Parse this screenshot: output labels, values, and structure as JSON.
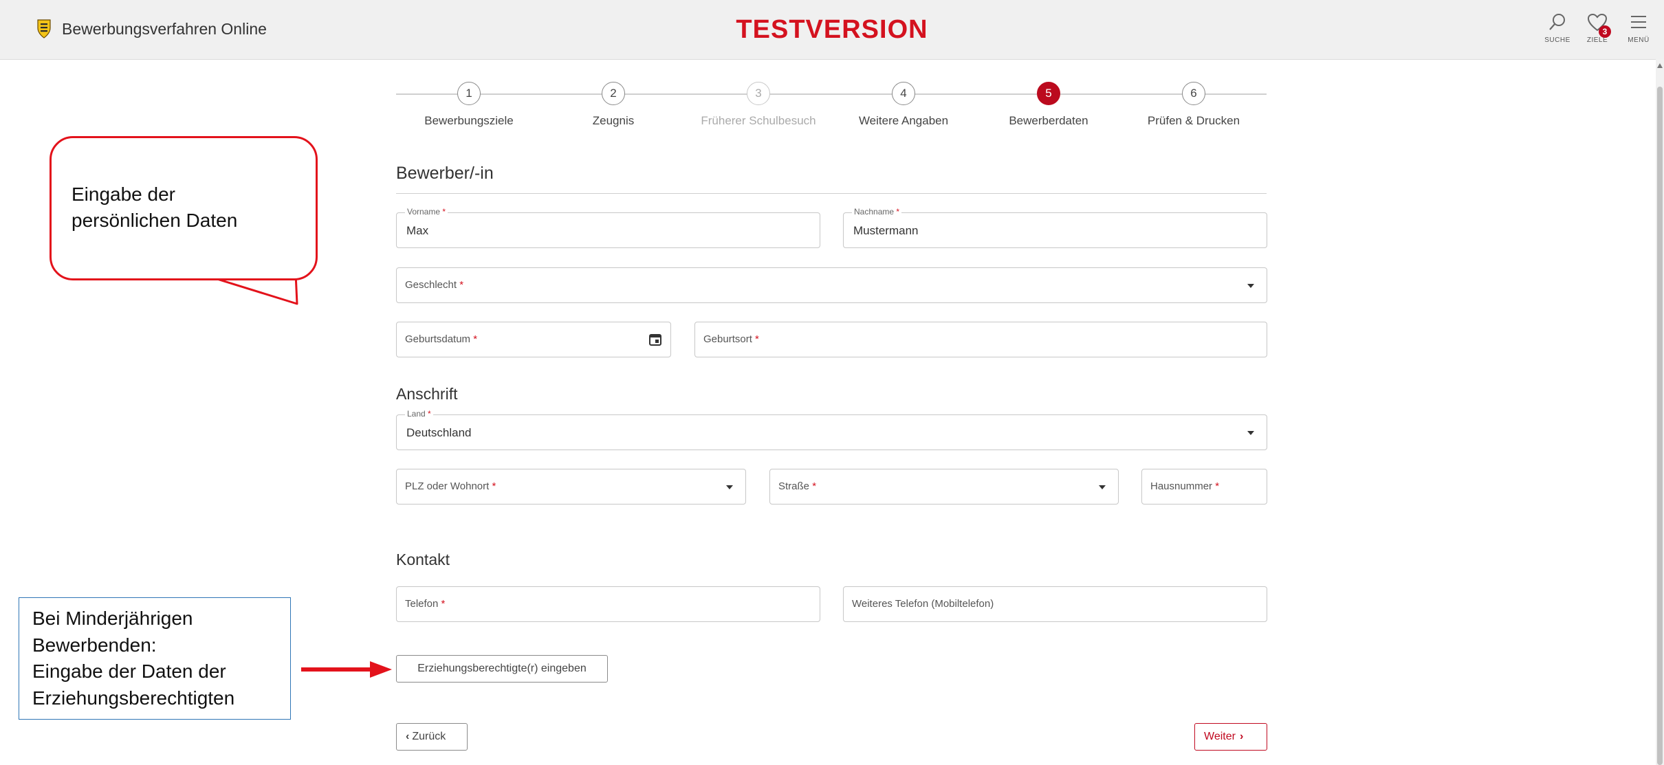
{
  "header": {
    "app_title": "Bewerbungsverfahren Online",
    "banner": "TESTVERSION",
    "search_label": "SUCHE",
    "goals_label": "ZIELE",
    "goals_count": "3",
    "menu_label": "MENÜ"
  },
  "steps": [
    {
      "number": "1",
      "label": "Bewerbungsziele",
      "state": "done"
    },
    {
      "number": "2",
      "label": "Zeugnis",
      "state": "done"
    },
    {
      "number": "3",
      "label": "Früherer Schulbesuch",
      "state": "disabled"
    },
    {
      "number": "4",
      "label": "Weitere Angaben",
      "state": "done"
    },
    {
      "number": "5",
      "label": "Bewerberdaten",
      "state": "active"
    },
    {
      "number": "6",
      "label": "Prüfen & Drucken",
      "state": "done"
    }
  ],
  "applicant": {
    "title": "Bewerber/-in",
    "firstname_label": "Vorname",
    "firstname_value": "Max",
    "lastname_label": "Nachname",
    "lastname_value": "Mustermann",
    "gender_placeholder": "Geschlecht",
    "birthdate_placeholder": "Geburtsdatum",
    "birthplace_placeholder": "Geburtsort"
  },
  "address": {
    "title": "Anschrift",
    "country_label": "Land",
    "country_value": "Deutschland",
    "zip_placeholder": "PLZ oder Wohnort",
    "street_placeholder": "Straße",
    "housenumber_placeholder": "Hausnummer"
  },
  "contact": {
    "title": "Kontakt",
    "phone_placeholder": "Telefon",
    "mobile_placeholder": "Weiteres Telefon (Mobiltelefon)"
  },
  "required_marker": "*",
  "buttons": {
    "guardian": "Erziehungsberechtigte(r) eingeben",
    "back": "Zurück",
    "next": "Weiter"
  },
  "annotations": {
    "bubble_line1": "Eingabe der",
    "bubble_line2": "persönlichen Daten",
    "minor_line1": "Bei Minderjährigen",
    "minor_line2": "Bewerbenden:",
    "minor_line3": "Eingabe der Daten der",
    "minor_line4": "Erziehungsberechtigten"
  },
  "colors": {
    "accent": "#bb0a1e",
    "banner": "#d4121f",
    "annotation_red": "#e3121b",
    "annotation_blue": "#2e75b6"
  }
}
